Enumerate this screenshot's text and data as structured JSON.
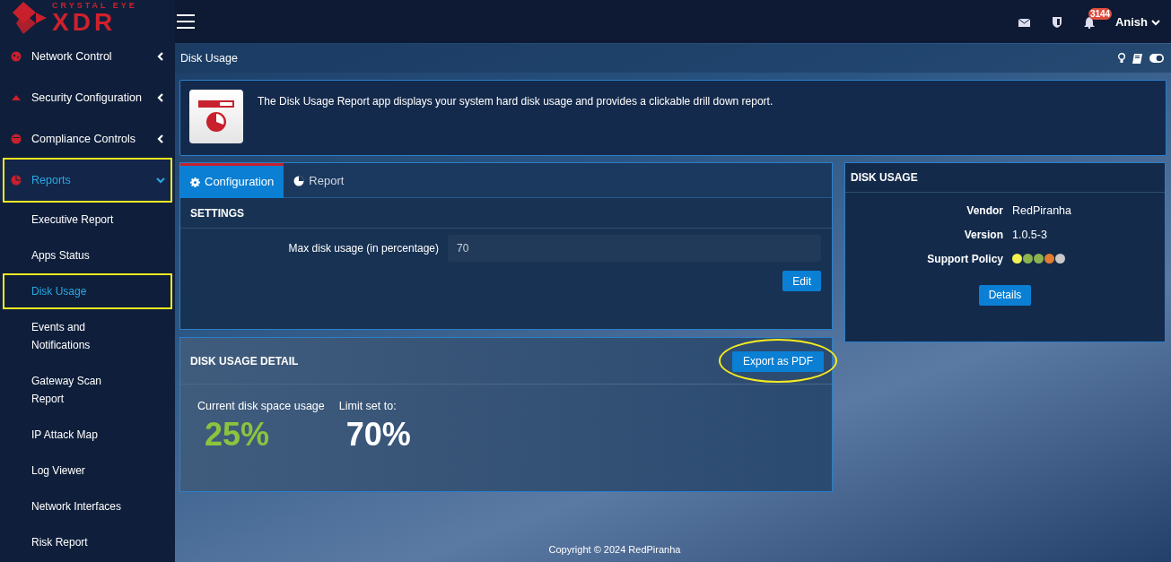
{
  "logo": {
    "tagline": "CRYSTAL EYE",
    "wordmark": "XDR"
  },
  "topbar": {
    "notification_count": "3144",
    "user": "Anish"
  },
  "sidebar": {
    "items": [
      {
        "label": "Network Control",
        "expanded": false,
        "selected": false,
        "highlighted": false
      },
      {
        "label": "Security Configuration",
        "expanded": false,
        "selected": false,
        "highlighted": false
      },
      {
        "label": "Compliance Controls",
        "expanded": false,
        "selected": false,
        "highlighted": false
      },
      {
        "label": "Reports",
        "expanded": true,
        "selected": true,
        "highlighted": true,
        "children": [
          {
            "label": "Executive Report",
            "selected": false,
            "highlighted": false
          },
          {
            "label": "Apps Status",
            "selected": false,
            "highlighted": false
          },
          {
            "label": "Disk Usage",
            "selected": true,
            "highlighted": true
          },
          {
            "label": "Events and Notifications",
            "selected": false,
            "highlighted": false
          },
          {
            "label": "Gateway Scan Report",
            "selected": false,
            "highlighted": false
          },
          {
            "label": "IP Attack Map",
            "selected": false,
            "highlighted": false
          },
          {
            "label": "Log Viewer",
            "selected": false,
            "highlighted": false
          },
          {
            "label": "Network Interfaces",
            "selected": false,
            "highlighted": false
          },
          {
            "label": "Risk Report",
            "selected": false,
            "highlighted": false
          }
        ]
      }
    ]
  },
  "page": {
    "title": "Disk Usage",
    "description": "The Disk Usage Report app displays your system hard disk usage and provides a clickable drill down report."
  },
  "tabs": [
    {
      "label": "Configuration",
      "selected": true
    },
    {
      "label": "Report",
      "selected": false
    }
  ],
  "settings": {
    "title": "SETTINGS",
    "field_label": "Max disk usage (in percentage)",
    "value": "70",
    "button": "Edit"
  },
  "detail": {
    "title": "DISK USAGE DETAIL",
    "button": "Export as PDF",
    "button_highlighted": true,
    "current_label": "Current disk space usage",
    "current_value": "25%",
    "limit_label": "Limit set to:",
    "limit_value": "70%"
  },
  "app_info": {
    "title": "DISK USAGE",
    "rows": [
      {
        "label": "Vendor",
        "value": "RedPiranha"
      },
      {
        "label": "Version",
        "value": "1.0.5-3"
      }
    ],
    "support_label": "Support Policy",
    "support_dots": [
      {
        "color": "#f2f24e"
      },
      {
        "color": "#8db34f"
      },
      {
        "color": "#8db34f"
      },
      {
        "color": "#e27d2f"
      },
      {
        "color": "#c9c9c9"
      }
    ],
    "button": "Details"
  },
  "footer": "Copyright © 2024 RedPiranha"
}
